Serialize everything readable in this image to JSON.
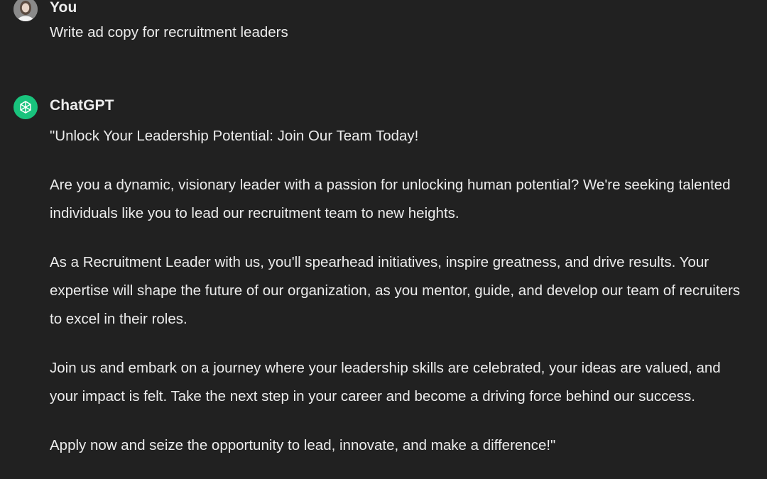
{
  "conversation": {
    "user": {
      "author": "You",
      "avatar_icon": "user-photo-avatar",
      "message": "Write ad copy for recruitment leaders"
    },
    "assistant": {
      "author": "ChatGPT",
      "avatar_icon": "openai-logo-icon",
      "avatar_color": "#19c37d",
      "paragraphs": [
        "\"Unlock Your Leadership Potential: Join Our Team Today!",
        "Are you a dynamic, visionary leader with a passion for unlocking human potential? We're seeking talented individuals like you to lead our recruitment team to new heights.",
        "As a Recruitment Leader with us, you'll spearhead initiatives, inspire greatness, and drive results. Your expertise will shape the future of our organization, as you mentor, guide, and develop our team of recruiters to excel in their roles.",
        "Join us and embark on a journey where your leadership skills are celebrated, your ideas are valued, and your impact is felt. Take the next step in your career and become a driving force behind our success.",
        "Apply now and seize the opportunity to lead, innovate, and make a difference!\""
      ]
    }
  },
  "theme": {
    "background": "#212121",
    "text": "#ececec"
  }
}
